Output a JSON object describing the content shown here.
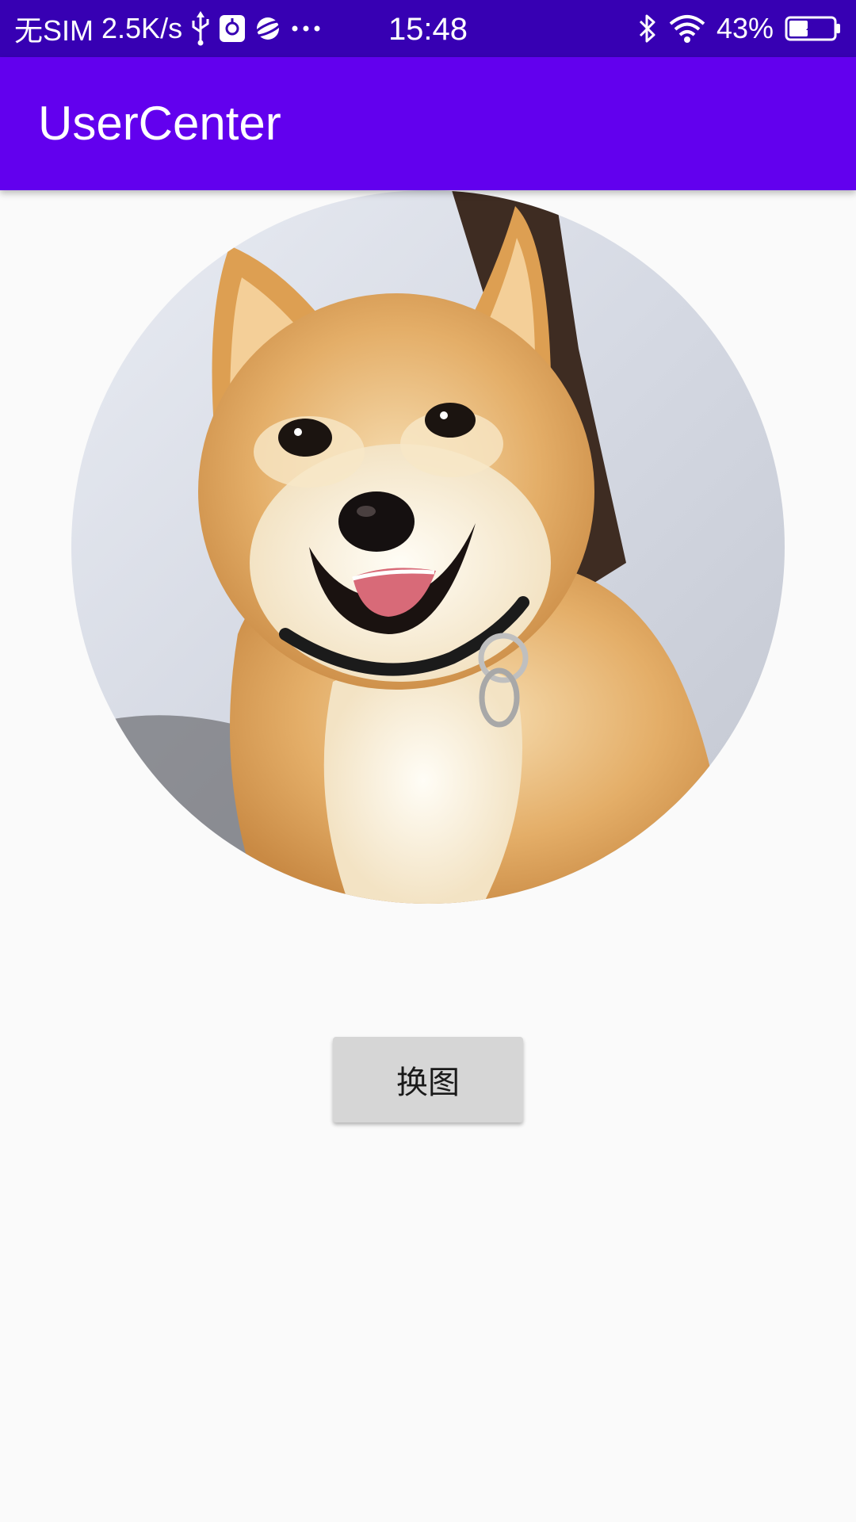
{
  "status_bar": {
    "carrier": "无SIM",
    "net_speed": "2.5K/s",
    "left_icons": [
      "usb-icon",
      "usb-debug-icon",
      "planet-app-icon",
      "more-dots-icon"
    ],
    "time": "15:48",
    "right_icons": [
      "bluetooth-icon",
      "wifi-icon",
      "battery-charging-icon"
    ],
    "battery_percent": "43%",
    "battery_level": 0.43
  },
  "app_bar": {
    "title": "UserCenter",
    "color": "#6200ee"
  },
  "avatar": {
    "subject": "shiba-inu-dog-photo"
  },
  "actions": {
    "swap_image_label": "换图"
  },
  "colors": {
    "status_bar": "#3700b3",
    "primary": "#6200ee",
    "background": "#fafafa",
    "button": "#d6d6d6"
  }
}
